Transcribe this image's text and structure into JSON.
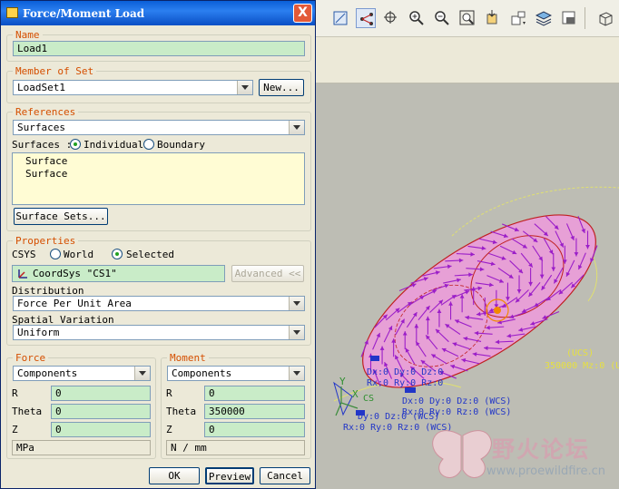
{
  "dialog": {
    "title": "Force/Moment Load",
    "close_label": "X",
    "name_group": {
      "legend": "Name",
      "value": "Load1"
    },
    "member_group": {
      "legend": "Member of Set",
      "value": "LoadSet1",
      "new_button": "New..."
    },
    "references_group": {
      "legend": "References",
      "type_value": "Surfaces",
      "surfaces_label": "Surfaces :",
      "radio_individual": "Individual",
      "radio_boundary": "Boundary",
      "items": [
        "Surface",
        "Surface"
      ],
      "surface_sets_button": "Surface Sets..."
    },
    "properties_group": {
      "legend": "Properties",
      "csys_label": "CSYS",
      "radio_world": "World",
      "radio_selected": "Selected",
      "coord_sys_value": "CoordSys \"CS1\"",
      "advanced_button": "Advanced <<",
      "distribution_label": "Distribution",
      "distribution_value": "Force Per Unit Area",
      "spatial_label": "Spatial Variation",
      "spatial_value": "Uniform"
    },
    "force_group": {
      "legend": "Force",
      "mode": "Components",
      "r_label": "R",
      "r_value": "0",
      "theta_label": "Theta",
      "theta_value": "0",
      "z_label": "Z",
      "z_value": "0",
      "units": "MPa"
    },
    "moment_group": {
      "legend": "Moment",
      "mode": "Components",
      "r_label": "R",
      "r_value": "0",
      "theta_label": "Theta",
      "theta_value": "350000",
      "z_label": "Z",
      "z_value": "0",
      "units": "N / mm"
    },
    "buttons": {
      "ok": "OK",
      "preview": "Preview",
      "cancel": "Cancel"
    }
  },
  "viewport": {
    "annotations": {
      "load_value": "350000 Mz:0 (U",
      "ucs": "(UCS)",
      "dof_1": "Dx:0 Dy:0 Dz:0",
      "dof_2": "Rx:0 Ry:0 Rz:0",
      "dof_3": "Dx:0 Dy:0 Dz:0 (WCS)",
      "dof_4": "Rx:0 Ry:0 Rz:0 (WCS)",
      "dof_5": "Dy:0 Dz:0 (WCS)",
      "dof_6": "Rx:0 Ry:0 Rz:0 (WCS)",
      "csys_label": "CS",
      "axis_y": "Y",
      "axis_x": "X"
    },
    "watermark_cn": "野火论坛",
    "watermark_url": "www.proewildfire.cn"
  },
  "colors": {
    "accent": "#d54f00",
    "field_bg": "#c9ecc8",
    "load_arrows": "#9b1ec8",
    "surface": "#e7a0d6"
  }
}
